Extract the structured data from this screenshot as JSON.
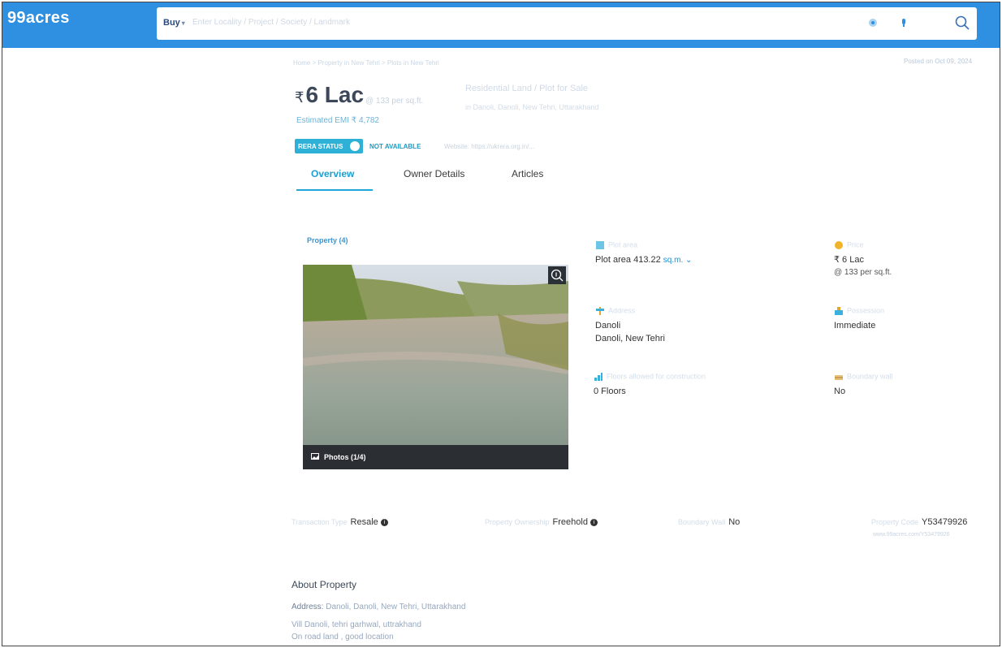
{
  "header": {
    "logo": "99acres",
    "buy": "Buy",
    "search_placeholder": "Enter Locality / Project / Society / Landmark"
  },
  "breadcrumb": "Home > Property in New Tehri > Plots in New Tehri",
  "posted_on": "Posted on Oct 09, 2024",
  "price": {
    "currency": "₹",
    "amount": "6 Lac",
    "per_sqft": "@ 133 per sq.ft."
  },
  "listing": {
    "title": "Residential Land / Plot for Sale",
    "subtitle": "in Danoli, Danoli, New Tehri, Uttarakhand"
  },
  "emi": "Estimated EMI ₹ 4,782",
  "rera": {
    "badge": "RERA STATUS",
    "status": "NOT AVAILABLE",
    "website": "Website: https://ukrera.org.in/..."
  },
  "tabs": [
    {
      "label": "Overview"
    },
    {
      "label": "Owner Details"
    },
    {
      "label": "Articles"
    }
  ],
  "photos": {
    "title": "Property (4)",
    "label": "Photos (1/4)"
  },
  "details": {
    "plot_area": {
      "label": "Plot area",
      "value": "Plot area 413.22",
      "unit": "sq.m."
    },
    "price": {
      "label": "Price",
      "value": "₹ 6 Lac",
      "per": "@ 133 per sq.ft."
    },
    "address": {
      "label": "Address",
      "line1": "Danoli",
      "line2": "Danoli, New Tehri"
    },
    "possession": {
      "label": "Possession",
      "value": "Immediate"
    },
    "floors": {
      "label": "Floors allowed for construction",
      "value": "0 Floors"
    },
    "boundary": {
      "label": "Boundary wall",
      "value": "No"
    }
  },
  "facts": [
    {
      "key": "Transaction Type",
      "value": "Resale",
      "info": true
    },
    {
      "key": "Property Ownership",
      "value": "Freehold",
      "info": true
    },
    {
      "key": "Boundary Wall",
      "value": "No"
    },
    {
      "key": "Property Code",
      "value": "Y53479926"
    }
  ],
  "facts_url": "www.99acres.com/Y53479926",
  "about": {
    "title": "About Property",
    "address_label": "Address:",
    "address": "Danoli, Danoli, New Tehri, Uttarakhand",
    "desc1": "Vill Danoli, tehri garhwal, uttrakhand",
    "desc2": "On road land , good location"
  },
  "icons": {
    "location": "location-icon",
    "mic": "mic-icon",
    "search": "search-icon",
    "zoom": "zoom-icon",
    "photo": "photo-icon"
  },
  "colors": {
    "brand": "#2f8fe0",
    "accent": "#1b9fd1",
    "photo_bar": "#2b2e33"
  }
}
